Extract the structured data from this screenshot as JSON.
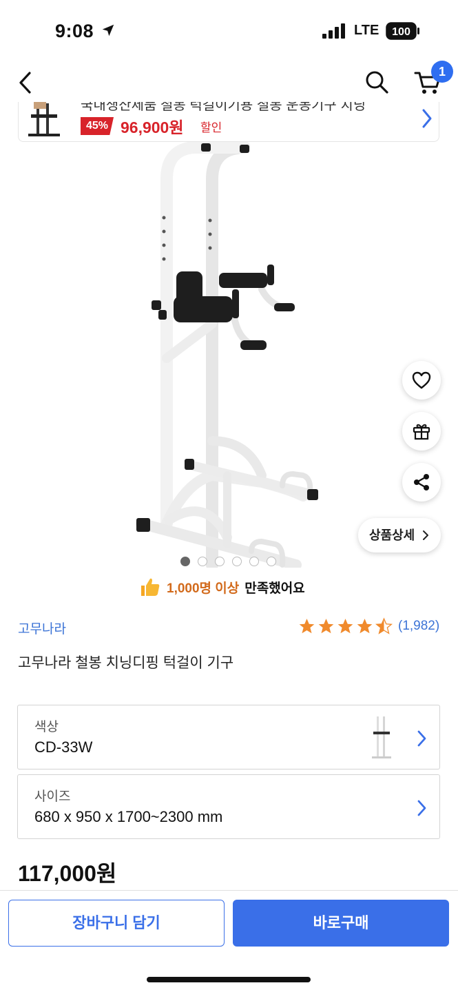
{
  "status_bar": {
    "time": "9:08",
    "network": "LTE",
    "battery": "100"
  },
  "header": {
    "cart_count": "1"
  },
  "promo": {
    "cut_text": "국내생산제품 철봉 턱걸이기용 철봉 운동기구 치닝",
    "discount_badge": "45%",
    "price": "96,900원",
    "discount_label": "할인"
  },
  "image": {
    "slide_count": 6,
    "active_slide": 1
  },
  "actions": {
    "detail_label": "상품상세"
  },
  "satisfaction": {
    "highlight": "1,000명 이상",
    "rest": "만족했어요"
  },
  "product": {
    "brand": "고무나라",
    "rating": 4.5,
    "review_count": "(1,982)",
    "title": "고무나라 철봉 치닝디핑 턱걸이 기구"
  },
  "options": [
    {
      "label": "색상",
      "value": "CD-33W"
    },
    {
      "label": "사이즈",
      "value": "680 x 950 x 1700~2300 mm"
    }
  ],
  "price": {
    "total": "117,000원"
  },
  "buttons": {
    "cart": "장바구니 담기",
    "buy": "바로구매"
  },
  "colors": {
    "accent": "#3a6fe8",
    "sale": "#d8232a",
    "star": "#f08a2c",
    "link": "#3b73d6"
  }
}
